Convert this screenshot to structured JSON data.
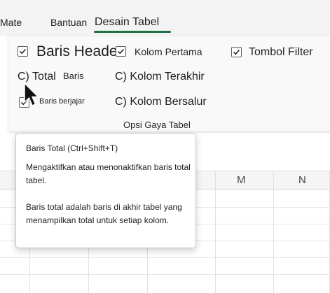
{
  "tabs": [
    {
      "label": "Mate"
    },
    {
      "label": "Bantuan"
    },
    {
      "label": "Desain Tabel",
      "active": true
    }
  ],
  "ribbon": {
    "options": {
      "header_row": {
        "label": "Baris Header",
        "checked": true
      },
      "total_row": {
        "label": "C) Total",
        "hint": "Baris"
      },
      "banded_rows": {
        "label": "Baris berjajar",
        "checked": true
      },
      "first_column": {
        "label": "Kolom Pertama",
        "checked": true
      },
      "last_column": {
        "label": "C) Kolom Terakhir"
      },
      "banded_columns": {
        "label": "C) Kolom Bersalur"
      },
      "filter_button": {
        "label": "Tombol Filter",
        "checked": true
      }
    },
    "group_label": "Opsi Gaya Tabel"
  },
  "sheet": {
    "columns": [
      "M",
      "N"
    ]
  },
  "tooltip": {
    "title": "Baris Total (Ctrl+Shift+T)",
    "desc1": "Mengaktifkan atau menonaktifkan baris total tabel.",
    "desc2": "Baris total adalah baris di akhir tabel yang menampilkan total untuk setiap kolom."
  },
  "colors": {
    "accent": "#1e7145",
    "ribbon_bg": "#f9f9f9",
    "tabbar_bg": "#f3f3f3"
  }
}
